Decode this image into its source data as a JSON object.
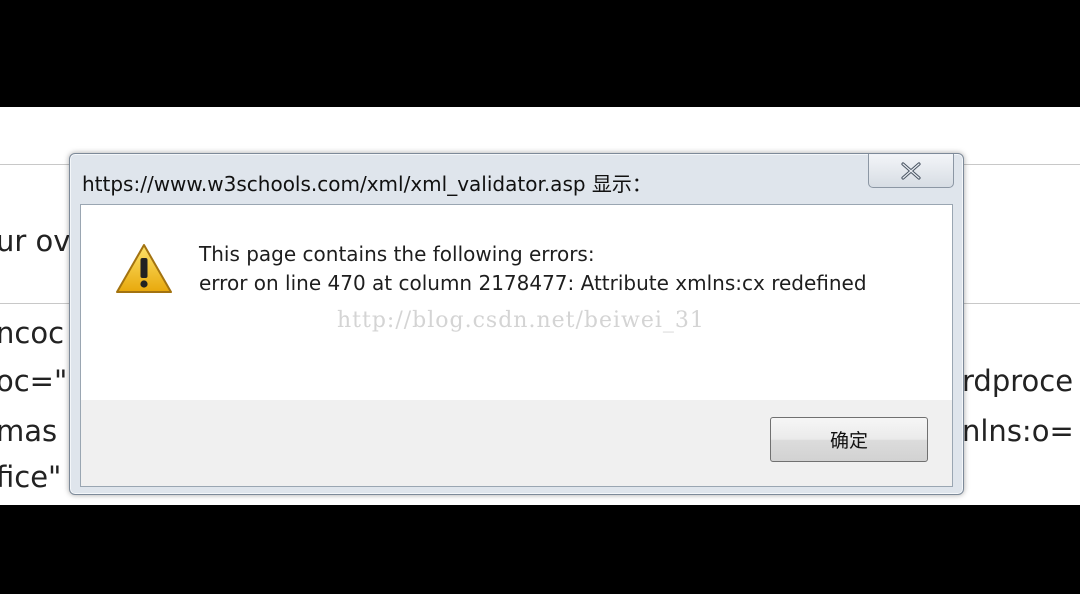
{
  "background": {
    "fragments": [
      "ur ov",
      "ncoc",
      "oc=\"",
      "mas",
      "fice\"",
      "rdproce",
      "nlns:o="
    ]
  },
  "dialog": {
    "title": "https://www.w3schools.com/xml/xml_validator.asp 显示：",
    "close_label": "✕",
    "message_line_1": "This page contains the following errors:",
    "message_line_2": "error on line 470 at column 2178477: Attribute xmlns:cx redefined",
    "watermark": "http://blog.csdn.net/beiwei_31",
    "ok_label": "确定",
    "warning_icon": "warning-icon"
  },
  "colors": {
    "warning_fill": "#f5c518",
    "dialog_frame": "#dfe5ec"
  }
}
